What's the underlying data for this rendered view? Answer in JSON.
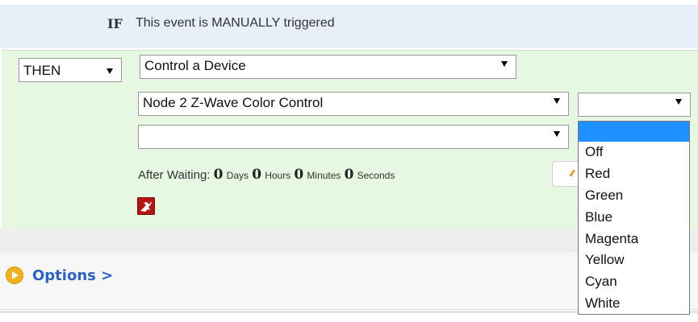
{
  "if_row": {
    "label": "IF",
    "text": "This event is MANUALLY triggered"
  },
  "then_row": {
    "type_select": {
      "value": "THEN"
    },
    "action_select": {
      "value": "Control a Device"
    },
    "device_select": {
      "value": "Node 2 Z-Wave Color Control"
    },
    "property_select": {
      "value": ""
    },
    "color_select": {
      "value": "",
      "options": [
        "Off",
        "Red",
        "Green",
        "Blue",
        "Magenta",
        "Yellow",
        "Cyan",
        "White"
      ]
    },
    "waiting": {
      "label": "After Waiting:",
      "days_value": "0",
      "days_label": "Days",
      "hours_value": "0",
      "hours_label": "Hours",
      "minutes_value": "0",
      "minutes_label": "Minutes",
      "seconds_value": "0",
      "seconds_label": "Seconds"
    }
  },
  "options": {
    "label": "Options >"
  },
  "colors": {
    "if_background": "#e7f0f8",
    "then_background": "#e7f8e2",
    "highlight": "#1e90ff",
    "link": "#2a62c8",
    "delete_icon": "#b41616",
    "options_icon": "#f2b11a"
  },
  "icons": {
    "delete": "delete-action-icon",
    "options": "play-circle-icon"
  }
}
